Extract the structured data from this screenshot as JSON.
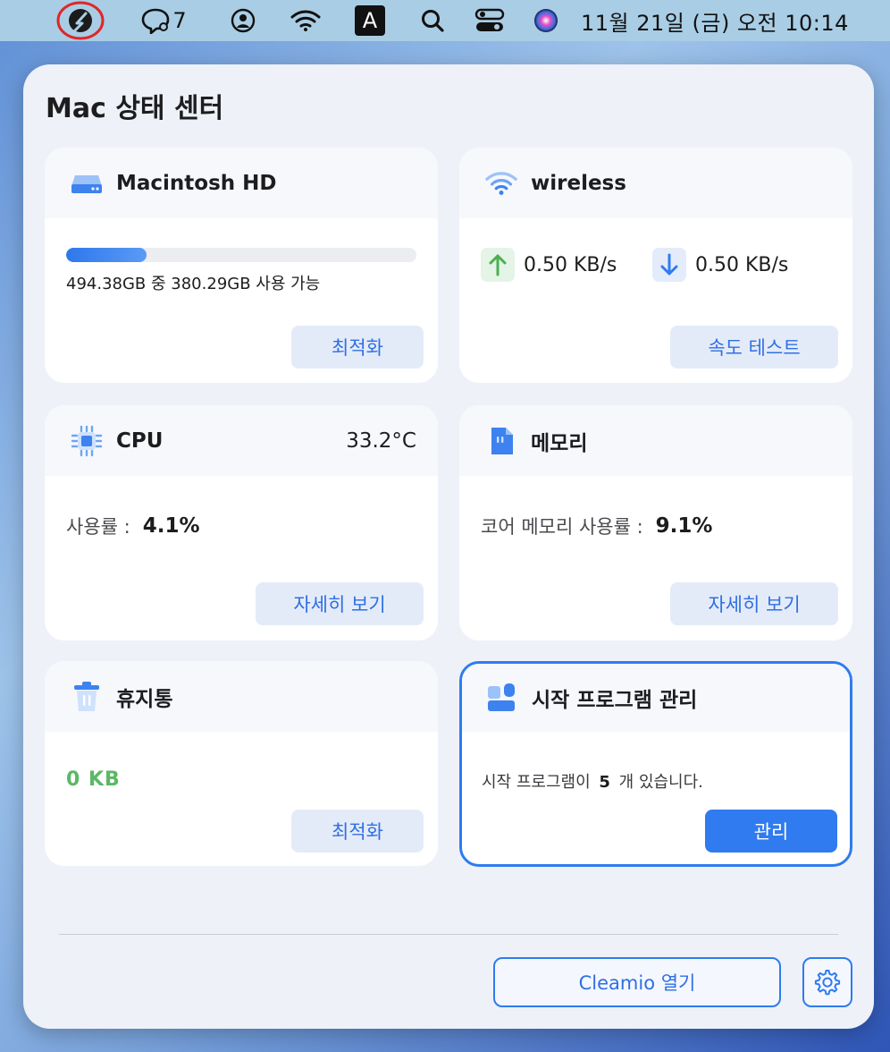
{
  "menubar": {
    "notification_count": "7",
    "input_source": "A",
    "clock": "11월 21일 (금) 오전  10:14",
    "icons": [
      "cleamio-icon",
      "chat-icon",
      "user-account-icon",
      "wifi-icon",
      "input-source-icon",
      "search-icon",
      "control-center-icon",
      "siri-icon"
    ]
  },
  "panel": {
    "title": "Mac 상태 센터"
  },
  "disk": {
    "title": "Macintosh HD",
    "usage_text": "494.38GB 중 380.29GB 사용 가능",
    "used_fraction": 0.23,
    "button": "최적화"
  },
  "network": {
    "title": "wireless",
    "upload": "0.50 KB/s",
    "download": "0.50 KB/s",
    "button": "속도 테스트"
  },
  "cpu": {
    "title": "CPU",
    "temperature": "33.2°C",
    "usage_label": "사용률 :",
    "usage_value": "4.1%",
    "button": "자세히 보기"
  },
  "memory": {
    "title": "메모리",
    "usage_label": "코어 메모리 사용률 :",
    "usage_value": "9.1%",
    "button": "자세히 보기"
  },
  "trash": {
    "title": "휴지통",
    "size": "0  KB",
    "button": "최적화"
  },
  "startup": {
    "title": "시작 프로그램 관리",
    "text_before": "시작 프로그램이",
    "count": "5",
    "text_after": "개 있습니다.",
    "button": "관리"
  },
  "footer": {
    "open_button": "Cleamio 열기",
    "settings_icon": "gear-icon"
  },
  "colors": {
    "accent": "#2f7bef",
    "upload_green": "#4caf50",
    "download_blue": "#2f7bef",
    "trash_green": "#5bb865"
  }
}
